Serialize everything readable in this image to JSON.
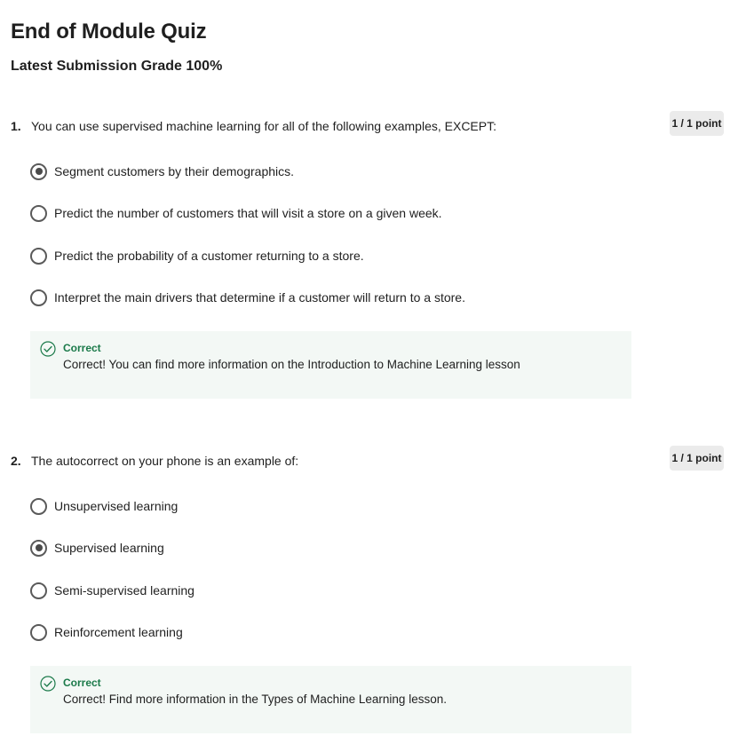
{
  "quiz": {
    "title": "End of Module Quiz",
    "grade": "Latest Submission Grade 100%"
  },
  "questions": [
    {
      "number": "1.",
      "text": "You can use supervised machine learning for all of the following examples, EXCEPT:",
      "points": "1 / 1 point",
      "options": [
        {
          "label": "Segment customers by their demographics.",
          "selected": true
        },
        {
          "label": "Predict the number of customers that will visit a store on a given week.",
          "selected": false
        },
        {
          "label": "Predict the probability of a customer returning to a store.",
          "selected": false
        },
        {
          "label": "Interpret the main drivers that determine if a customer will return to a store.",
          "selected": false
        }
      ],
      "feedback": {
        "status": "Correct",
        "message": "Correct! You can find more information on the Introduction to Machine Learning lesson"
      }
    },
    {
      "number": "2.",
      "text": "The autocorrect on your phone is an example of:",
      "points": "1 / 1 point",
      "options": [
        {
          "label": "Unsupervised learning",
          "selected": false
        },
        {
          "label": "Supervised learning",
          "selected": true
        },
        {
          "label": "Semi-supervised learning",
          "selected": false
        },
        {
          "label": "Reinforcement learning",
          "selected": false
        }
      ],
      "feedback": {
        "status": "Correct",
        "message": "Correct! Find more information in the Types of Machine Learning lesson."
      }
    }
  ],
  "colors": {
    "correct_green": "#1b7a4a",
    "feedback_bg": "#f3f8f5",
    "points_bg": "#ebebeb"
  },
  "icons": {
    "feedback": "check-circle-icon",
    "option": "radio-button-icon"
  }
}
